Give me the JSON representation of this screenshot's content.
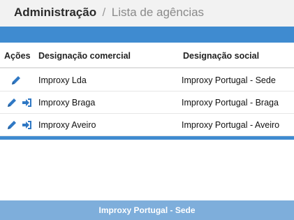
{
  "header": {
    "title": "Administração",
    "separator": "/",
    "subtitle": "Lista de agências"
  },
  "table": {
    "columns": {
      "actions": "Ações",
      "commercial": "Designação comercial",
      "social": "Designação social"
    },
    "rows": [
      {
        "commercial": "Improxy Lda",
        "social": "Improxy Portugal - Sede",
        "actions": [
          "edit-icon"
        ]
      },
      {
        "commercial": "Improxy Braga",
        "social": "Improxy Portugal - Braga",
        "actions": [
          "edit-icon",
          "login-icon"
        ]
      },
      {
        "commercial": "Improxy Aveiro",
        "social": "Improxy Portugal - Aveiro",
        "actions": [
          "edit-icon",
          "login-icon"
        ]
      }
    ]
  },
  "footer": {
    "text": "Improxy Portugal - Sede"
  },
  "colors": {
    "accent": "#3f8bd0",
    "footer": "#7eaedb",
    "header_bg": "#f2f2f2"
  }
}
